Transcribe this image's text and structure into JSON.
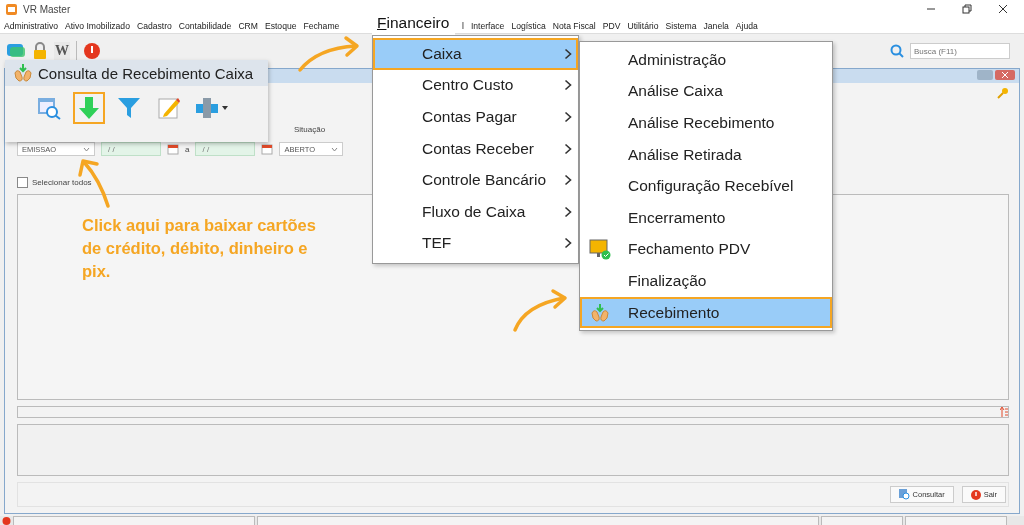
{
  "window": {
    "title": "VR Master"
  },
  "menu_bar": {
    "left": [
      "Administrativo",
      "Ativo Imobilizado",
      "Cadastro",
      "Contabilidade",
      "CRM",
      "Estoque",
      "Fechame"
    ],
    "right": [
      "l",
      "Interface",
      "Logística",
      "Nota Fiscal",
      "PDV",
      "Utilitário",
      "Sistema",
      "Janela",
      "Ajuda"
    ]
  },
  "app_toolbar": [
    {
      "kind": "chat"
    },
    {
      "kind": "lock"
    },
    {
      "kind": "letter",
      "glyph": "W"
    },
    {
      "kind": "stop"
    }
  ],
  "search": {
    "placeholder": "Busca (F11)"
  },
  "filters": {
    "date_type": "EMISSAO",
    "date_from": "/ /",
    "separator": "a",
    "date_to": "/ /",
    "status_label": "Situação",
    "status": "ABERTO"
  },
  "select_all": {
    "label": "Selecionar todos",
    "checked": false
  },
  "buttons": [
    {
      "kind": "search",
      "label": "Consultar"
    },
    {
      "kind": "exit",
      "label": "Sair"
    }
  ],
  "consulta_panel": {
    "title": "Consulta de Recebimento Caixa",
    "tools": [
      {
        "kind": "view",
        "highlighted": false
      },
      {
        "kind": "download",
        "highlighted": true
      },
      {
        "kind": "filter",
        "highlighted": false
      },
      {
        "kind": "edit",
        "highlighted": false
      },
      {
        "kind": "print",
        "highlighted": false
      }
    ]
  },
  "callout": {
    "text": "Click aqui para baixar cartões de crédito, débito, dinheiro e pix."
  },
  "financeiro_menu": {
    "title": "Financeiro",
    "items": [
      {
        "label": "Caixa",
        "selected": true
      },
      {
        "label": "Centro Custo",
        "selected": false
      },
      {
        "label": "Contas Pagar",
        "selected": false
      },
      {
        "label": "Contas Receber",
        "selected": false
      },
      {
        "label": "Controle Bancário",
        "selected": false
      },
      {
        "label": "Fluxo de Caixa",
        "selected": false
      },
      {
        "label": "TEF",
        "selected": false
      }
    ]
  },
  "caixa_submenu": {
    "items": [
      {
        "label": "Administração",
        "kind": "plain",
        "selected": false
      },
      {
        "label": "Análise Caixa",
        "kind": "plain",
        "selected": false
      },
      {
        "label": "Análise Recebimento",
        "kind": "plain",
        "selected": false
      },
      {
        "label": "Análise Retirada",
        "kind": "plain",
        "selected": false
      },
      {
        "label": "Configuração Recebível",
        "kind": "plain",
        "selected": false
      },
      {
        "label": "Encerramento",
        "kind": "plain",
        "selected": false
      },
      {
        "label": "Fechamento PDV",
        "kind": "pdv",
        "selected": false
      },
      {
        "label": "Finalização",
        "kind": "plain",
        "selected": false
      },
      {
        "label": "Recebimento",
        "kind": "receipt",
        "selected": true
      }
    ]
  }
}
